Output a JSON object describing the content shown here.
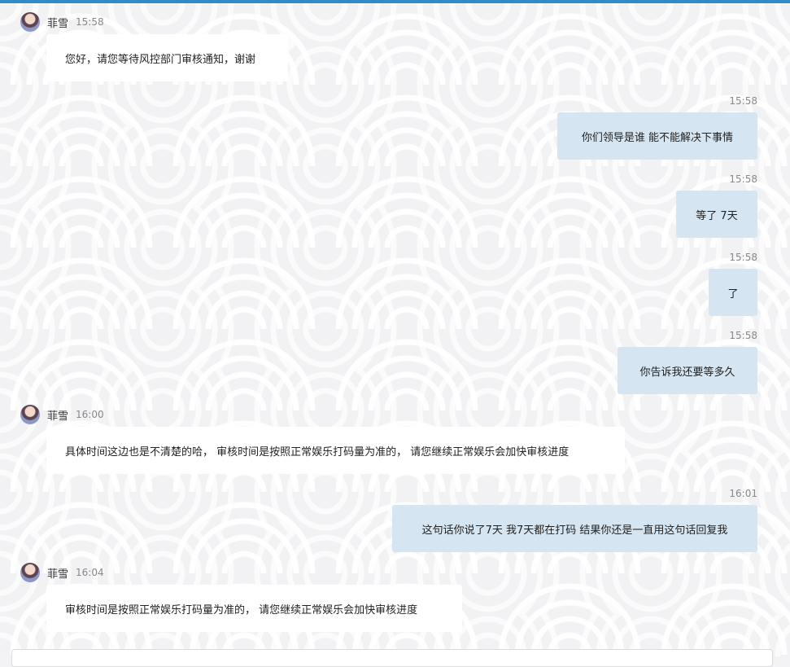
{
  "messages": [
    {
      "side": "in",
      "sender": "菲雪",
      "time": "15:58",
      "text": "您好，请您等待风控部门审核通知，谢谢"
    },
    {
      "side": "out",
      "time": "15:58",
      "text": "你们领导是谁 能不能解决下事情"
    },
    {
      "side": "out",
      "time": "15:58",
      "text": "等了 7天"
    },
    {
      "side": "out",
      "time": "15:58",
      "text": "了"
    },
    {
      "side": "out",
      "time": "15:58",
      "text": "你告诉我还要等多久"
    },
    {
      "side": "in",
      "sender": "菲雪",
      "time": "16:00",
      "text": "具体时间这边也是不清楚的哈， 审核时间是按照正常娱乐打码量为准的， 请您继续正常娱乐会加快审核进度"
    },
    {
      "side": "out",
      "time": "16:01",
      "text": "这句话你说了7天 我7天都在打码 结果你还是一直用这句话回复我"
    },
    {
      "side": "in",
      "sender": "菲雪",
      "time": "16:04",
      "text": "审核时间是按照正常娱乐打码量为准的， 请您继续正常娱乐会加快审核进度"
    }
  ],
  "colors": {
    "accent": "#2e8dc8",
    "incoming_bubble": "#ffffff",
    "outgoing_bubble": "#d5e5f1"
  }
}
